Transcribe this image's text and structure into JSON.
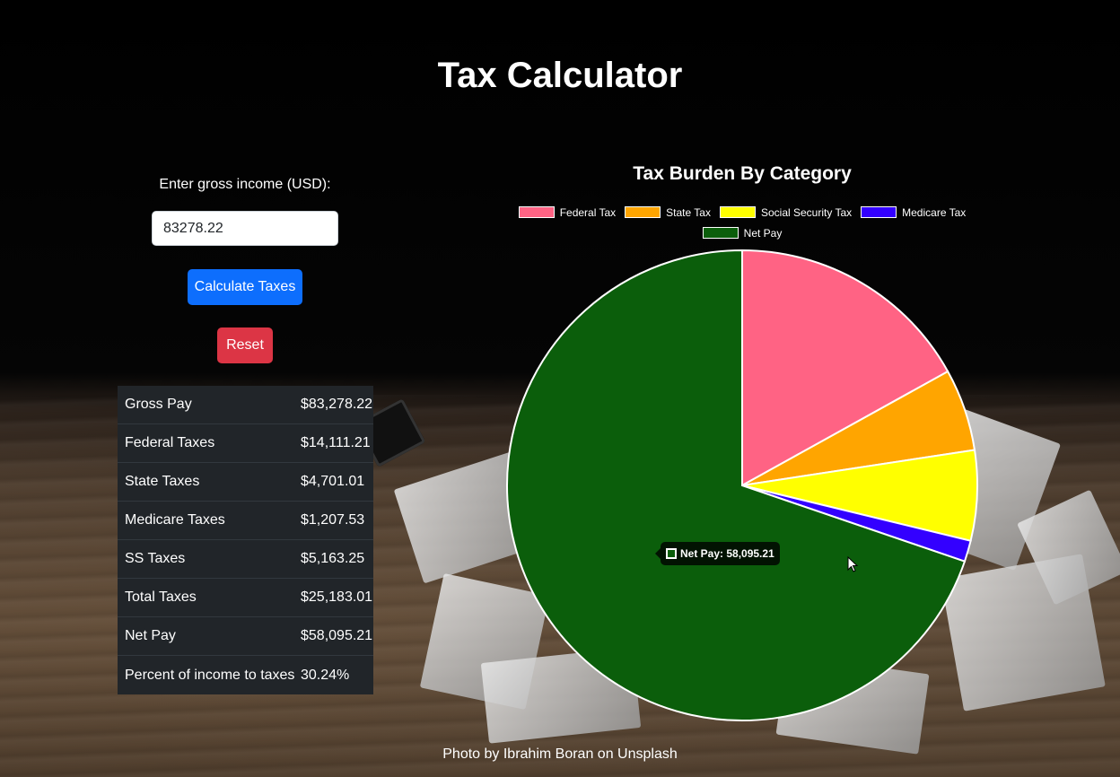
{
  "page": {
    "title": "Tax Calculator"
  },
  "form": {
    "label": "Enter gross income (USD):",
    "income_value": "83278.22",
    "calculate_label": "Calculate Taxes",
    "reset_label": "Reset"
  },
  "results": [
    {
      "label": "Gross Pay",
      "value": "$83,278.22"
    },
    {
      "label": "Federal Taxes",
      "value": "$14,111.21"
    },
    {
      "label": "State Taxes",
      "value": "$4,701.01"
    },
    {
      "label": "Medicare Taxes",
      "value": "$1,207.53"
    },
    {
      "label": "SS Taxes",
      "value": "$5,163.25"
    },
    {
      "label": "Total Taxes",
      "value": "$25,183.01"
    },
    {
      "label": "Net Pay",
      "value": "$58,095.21"
    },
    {
      "label": "Percent of income to taxes",
      "value": "30.24%"
    }
  ],
  "chart_data": {
    "type": "pie",
    "title": "Tax Burden By Category",
    "legend_position": "top",
    "categories": [
      "Federal Tax",
      "State Tax",
      "Social Security Tax",
      "Medicare Tax",
      "Net Pay"
    ],
    "values": [
      14111.21,
      4701.01,
      5163.25,
      1207.53,
      58095.21
    ],
    "colors": [
      "#ff6384",
      "#ffa500",
      "#ffff00",
      "#3300ff",
      "#0b5e0b"
    ],
    "tooltip": {
      "label": "Net Pay: 58,095.21",
      "category": "Net Pay"
    }
  },
  "footer": {
    "credit": "Photo by Ibrahim Boran on Unsplash"
  },
  "icons": {
    "cursor": "mouse-pointer-icon"
  }
}
